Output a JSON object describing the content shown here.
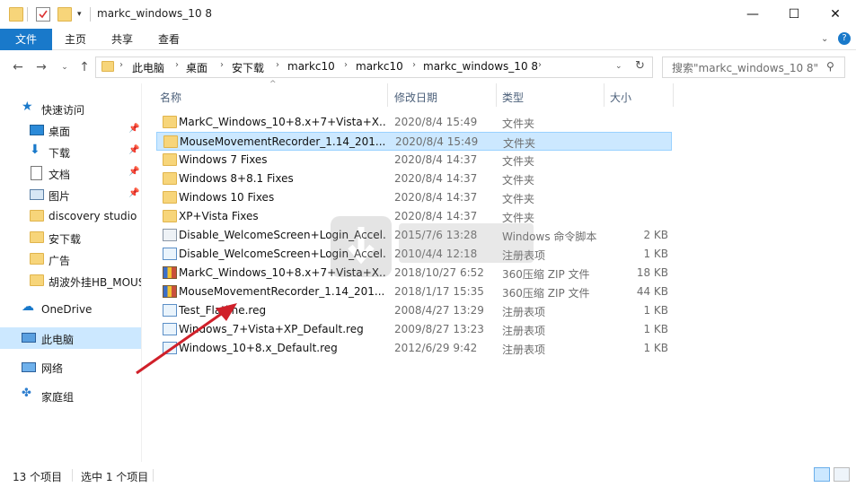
{
  "window": {
    "title": "markc_windows_10 8",
    "minimize_glyph": "—",
    "maximize_glyph": "☐",
    "close_glyph": "✕"
  },
  "ribbon": {
    "tabs": [
      "文件",
      "主页",
      "共享",
      "查看"
    ]
  },
  "address": {
    "breadcrumbs": [
      "此电脑",
      "桌面",
      "安下载",
      "markc10",
      "markc10",
      "markc_windows_10 8"
    ],
    "search_placeholder": "搜索\"markc_windows_10 8\""
  },
  "sidebar": {
    "items": [
      {
        "label": "快速访问",
        "icon": "star-icon"
      },
      {
        "label": "桌面",
        "icon": "desktop-icon",
        "pinned": true
      },
      {
        "label": "下载",
        "icon": "download-icon",
        "pinned": true
      },
      {
        "label": "文档",
        "icon": "document-icon",
        "pinned": true
      },
      {
        "label": "图片",
        "icon": "picture-icon",
        "pinned": true
      },
      {
        "label": "discovery studio 2",
        "icon": "folder-icon"
      },
      {
        "label": "安下载",
        "icon": "folder-icon"
      },
      {
        "label": "广告",
        "icon": "folder-icon"
      },
      {
        "label": "胡波外挂HB_MOUS",
        "icon": "folder-icon"
      },
      {
        "label": "OneDrive",
        "icon": "cloud-icon"
      },
      {
        "label": "此电脑",
        "icon": "computer-icon",
        "selected": true
      },
      {
        "label": "网络",
        "icon": "network-icon"
      },
      {
        "label": "家庭组",
        "icon": "homegroup-icon"
      }
    ]
  },
  "columns": [
    "名称",
    "修改日期",
    "类型",
    "大小"
  ],
  "files": [
    {
      "name": "MarkC_Windows_10+8.x+7+Vista+X...",
      "date": "2020/8/4 15:49",
      "type": "文件夹",
      "size": "",
      "kind": "folder"
    },
    {
      "name": "MouseMovementRecorder_1.14_201...",
      "date": "2020/8/4 15:49",
      "type": "文件夹",
      "size": "",
      "kind": "folder",
      "selected": true
    },
    {
      "name": "Windows 7 Fixes",
      "date": "2020/8/4 14:37",
      "type": "文件夹",
      "size": "",
      "kind": "folder"
    },
    {
      "name": "Windows 8+8.1 Fixes",
      "date": "2020/8/4 14:37",
      "type": "文件夹",
      "size": "",
      "kind": "folder"
    },
    {
      "name": "Windows 10 Fixes",
      "date": "2020/8/4 14:37",
      "type": "文件夹",
      "size": "",
      "kind": "folder"
    },
    {
      "name": "XP+Vista Fixes",
      "date": "2020/8/4 14:37",
      "type": "文件夹",
      "size": "",
      "kind": "folder"
    },
    {
      "name": "Disable_WelcomeScreen+Login_Accel...",
      "date": "2015/7/6 13:28",
      "type": "Windows 命令脚本",
      "size": "2 KB",
      "kind": "bat"
    },
    {
      "name": "Disable_WelcomeScreen+Login_Accel...",
      "date": "2010/4/4 12:18",
      "type": "注册表项",
      "size": "1 KB",
      "kind": "reg"
    },
    {
      "name": "MarkC_Windows_10+8.x+7+Vista+X...",
      "date": "2018/10/27 6:52",
      "type": "360压缩 ZIP 文件",
      "size": "18 KB",
      "kind": "zip"
    },
    {
      "name": "MouseMovementRecorder_1.14_201...",
      "date": "2018/1/17 15:35",
      "type": "360压缩 ZIP 文件",
      "size": "44 KB",
      "kind": "zip"
    },
    {
      "name": "Test_Flatline.reg",
      "date": "2008/4/27 13:29",
      "type": "注册表项",
      "size": "1 KB",
      "kind": "reg"
    },
    {
      "name": "Windows_7+Vista+XP_Default.reg",
      "date": "2009/8/27 13:23",
      "type": "注册表项",
      "size": "1 KB",
      "kind": "reg"
    },
    {
      "name": "Windows_10+8.x_Default.reg",
      "date": "2012/6/29 9:42",
      "type": "注册表项",
      "size": "1 KB",
      "kind": "reg"
    }
  ],
  "status": {
    "item_count": "13 个项目",
    "selected_count": "选中 1 个项目"
  },
  "colors": {
    "accent": "#1979ca",
    "selection": "#cce8ff",
    "arrow": "#d0202a"
  }
}
